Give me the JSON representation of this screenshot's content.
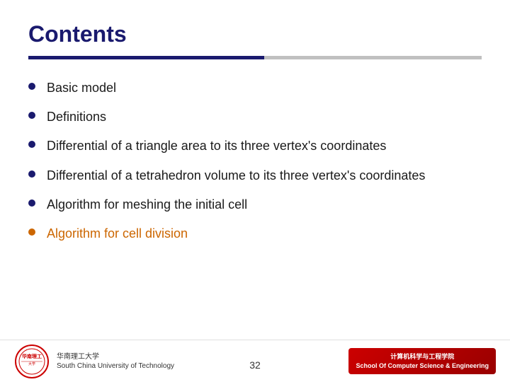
{
  "slide": {
    "title": "Contents",
    "divider": {
      "blue_color": "#1a1a6e",
      "gray_color": "#c0c0c0"
    },
    "items": [
      {
        "id": 1,
        "text": "Basic model",
        "highlight": false
      },
      {
        "id": 2,
        "text": "Definitions",
        "highlight": false
      },
      {
        "id": 3,
        "text": "Differential of a triangle area to its three vertex's coordinates",
        "highlight": false
      },
      {
        "id": 4,
        "text": "Differential of a tetrahedron volume to its three vertex's coordinates",
        "highlight": false
      },
      {
        "id": 5,
        "text": "Algorithm for meshing the initial cell",
        "highlight": false
      },
      {
        "id": 6,
        "text": "Algorithm for cell division",
        "highlight": true
      }
    ],
    "footer": {
      "university_name": "South China University of Technology",
      "page_number": "32",
      "school_label": "计算机科学与工程学院\nSchool Of Computer Science & Engineering"
    }
  }
}
